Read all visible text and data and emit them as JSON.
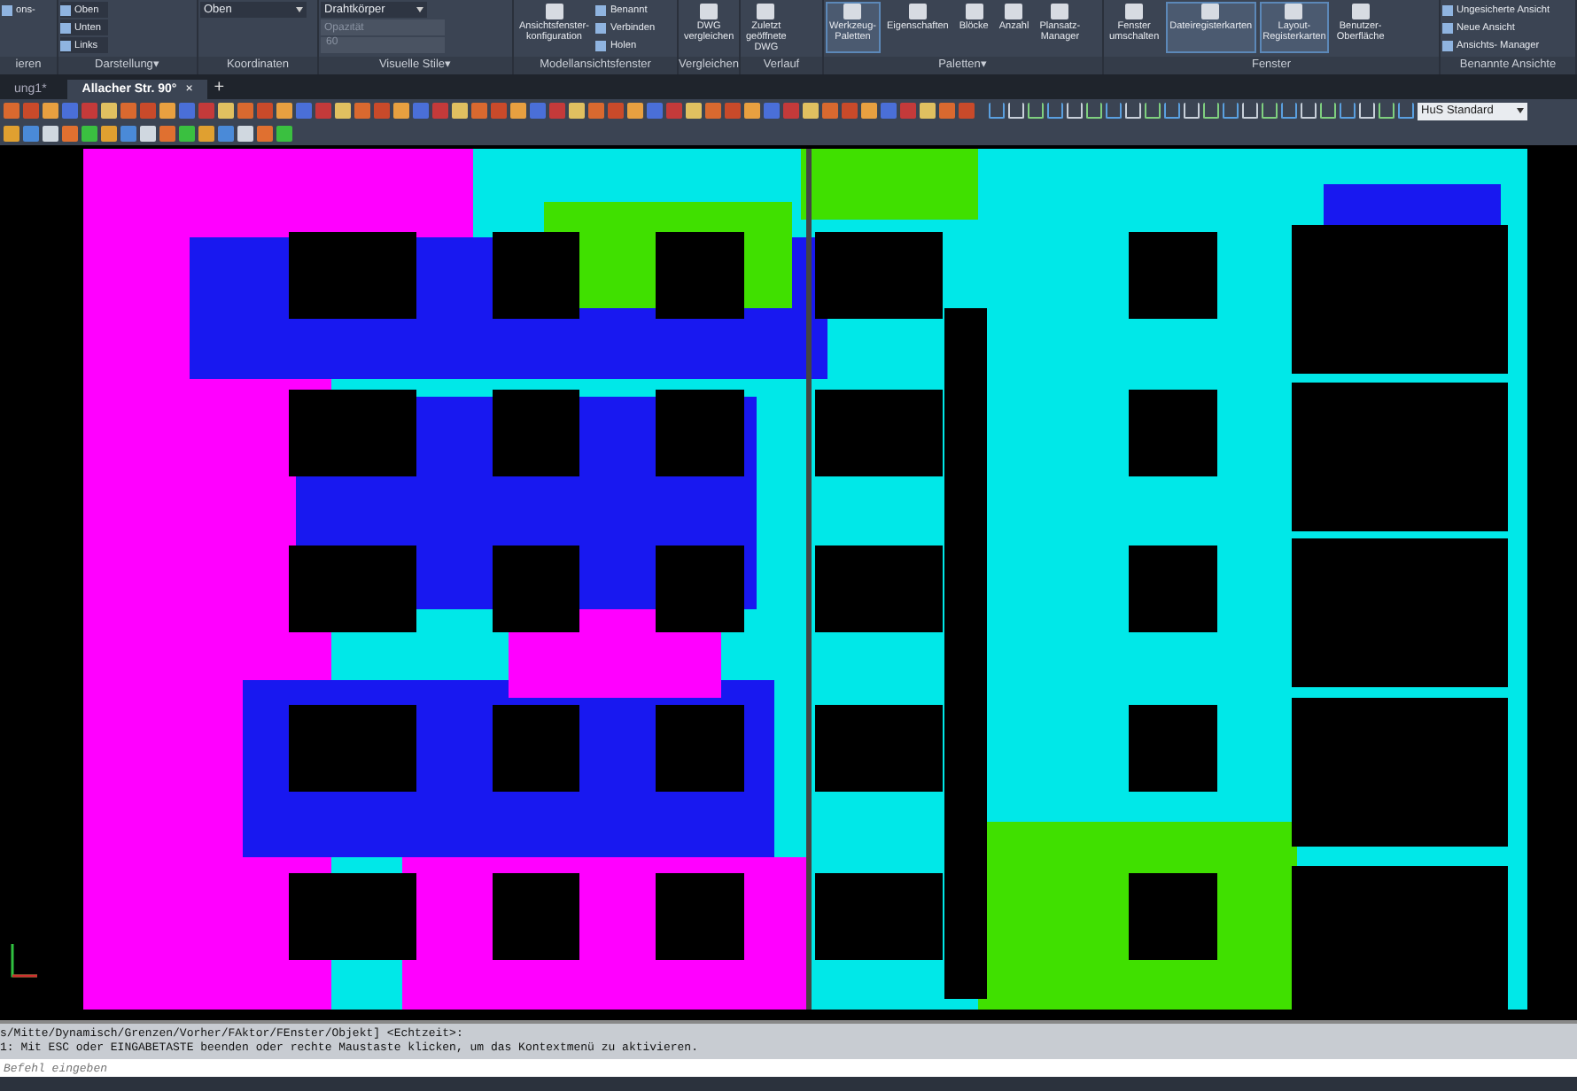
{
  "ribbon": {
    "groups": [
      {
        "label": "ieren",
        "items": [
          {
            "kind": "small",
            "label": "ons-"
          }
        ]
      },
      {
        "label": "Darstellung",
        "menu": "▾",
        "items": [
          {
            "kind": "list",
            "label": "Oben"
          },
          {
            "kind": "list",
            "label": "Unten"
          },
          {
            "kind": "list",
            "label": "Links"
          }
        ]
      },
      {
        "label": "Koordinaten",
        "items": [
          {
            "kind": "dropdown",
            "label": "Oben"
          }
        ]
      },
      {
        "label": "Visuelle Stile",
        "menu": "▾",
        "items": [
          {
            "kind": "dropdown",
            "label": "Drahtkörper"
          },
          {
            "kind": "field",
            "placeholder": "Opazität"
          },
          {
            "kind": "readout",
            "label": "60"
          }
        ]
      },
      {
        "label": "Modellansichtsfenster",
        "items": [
          {
            "kind": "large",
            "label": "Ansichtsfenster-konfiguration",
            "selected": false
          },
          {
            "kind": "small",
            "label": "Benannt"
          },
          {
            "kind": "small",
            "label": "Verbinden"
          },
          {
            "kind": "small",
            "label": "Holen"
          }
        ]
      },
      {
        "label": "Vergleichen",
        "items": [
          {
            "kind": "large",
            "label": "DWG vergleichen",
            "selected": false
          }
        ]
      },
      {
        "label": "Verlauf",
        "items": [
          {
            "kind": "large",
            "label": "Zuletzt geöffnete DWG",
            "selected": false
          }
        ]
      },
      {
        "label": "Paletten",
        "menu": "▾",
        "items": [
          {
            "kind": "large",
            "label": "Werkzeug-Paletten",
            "selected": true
          },
          {
            "kind": "large",
            "label": "Eigenschaften",
            "selected": false
          },
          {
            "kind": "large",
            "label": "Blöcke",
            "selected": false
          },
          {
            "kind": "large",
            "label": "Anzahl",
            "selected": false
          },
          {
            "kind": "large",
            "label": "Plansatz-Manager",
            "selected": false
          }
        ]
      },
      {
        "label": "Fenster",
        "items": [
          {
            "kind": "large",
            "label": "Fenster umschalten",
            "selected": false
          },
          {
            "kind": "large",
            "label": "Dateiregisterkarten",
            "selected": true
          },
          {
            "kind": "large",
            "label": "Layout-Registerkarten",
            "selected": true
          },
          {
            "kind": "large",
            "label": "Benutzer-Oberfläche",
            "selected": false
          }
        ]
      },
      {
        "label": "Benannte Ansichte",
        "items": [
          {
            "kind": "small",
            "label": "Ungesicherte Ansicht"
          },
          {
            "kind": "small",
            "label": "Neue Ansicht"
          },
          {
            "kind": "small",
            "label": "Ansichts- Manager"
          }
        ]
      }
    ]
  },
  "tabs": [
    {
      "label": "ung1*",
      "selected": false
    },
    {
      "label": "Allacher Str. 90°",
      "selected": true,
      "close": "×"
    }
  ],
  "new_tab": "+",
  "toolbar": {
    "style_dropdown": "HuS Standard"
  },
  "command_line": {
    "history": [
      "s/Mitte/Dynamisch/Grenzen/Vorher/FAktor/FEnster/Objekt] <Echtzeit>:",
      "1:  Mit ESC oder EINGABETASTE beenden oder rechte Maustaste klicken, um das Kontextmenü zu aktivieren."
    ],
    "placeholder": "Befehl eingeben"
  }
}
